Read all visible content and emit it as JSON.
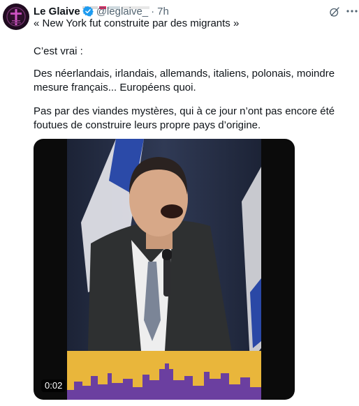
{
  "tweet": {
    "display_name": "Le Glaive",
    "handle": "@leglaive_",
    "separator": "·",
    "time": "7h",
    "paragraphs": [
      "« New York fut construite par des migrants »",
      "C’est vrai :",
      "Des néerlandais, irlandais, allemands, italiens, polonais, moindre mesure français... Européens quoi.",
      "Pas par des viandes mystères, qui à ce jour n’ont pas encore été foutues de construire leurs propre pays d’origine."
    ]
  },
  "media": {
    "duration": "0:02"
  },
  "icons": {
    "verified": "verified-badge-icon",
    "grok": "grok-icon",
    "more": "more-icon"
  },
  "colors": {
    "verified": "#1d9bf0",
    "secondary_text": "#536471",
    "primary_text": "#0f1419"
  }
}
